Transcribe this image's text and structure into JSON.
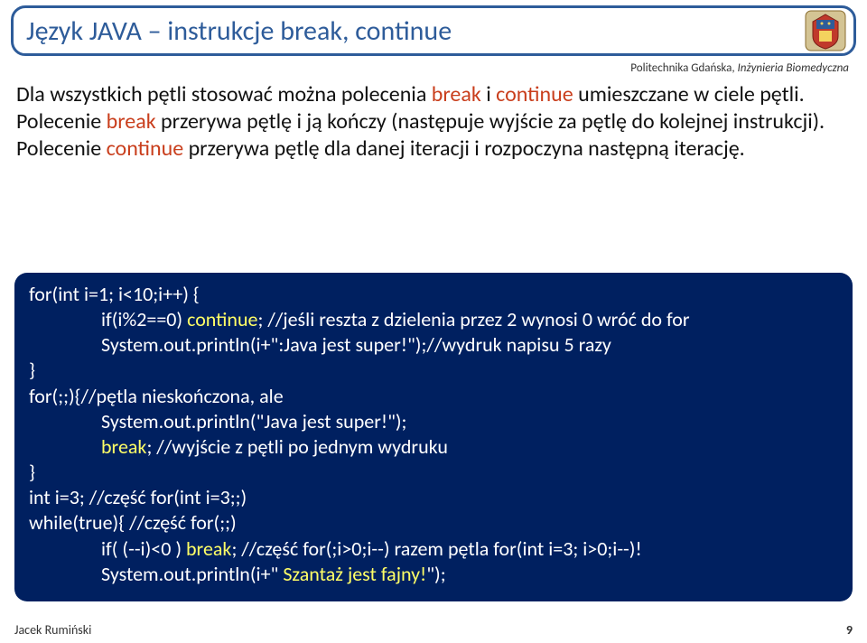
{
  "title": "Język JAVA – instrukcje break, continue",
  "subheader": {
    "uni": "Politechnika Gdańska, ",
    "dept": "Inżynieria Biomedyczna"
  },
  "para": {
    "p1a": "Dla wszystkich pętli stosować można polecenia ",
    "p1b": "break",
    "p1c": " i ",
    "p1d": "continue",
    "p1e": " umieszczane w ciele pętli. Polecenie ",
    "p1f": "break",
    "p1g": " przerywa pętlę i ją kończy (następuje wyjście za pętlę do kolejnej instrukcji). Polecenie ",
    "p1h": "continue",
    "p1i": " przerywa pętlę dla danej iteracji i rozpoczyna następną iterację."
  },
  "code": {
    "l1": "for(int i=1; i<10;i++) {",
    "l2a": "if(i%2==0) ",
    "l2b": "continue",
    "l2c": "; //jeśli reszta z dzielenia przez 2 wynosi 0  wróć do for",
    "l3": "System.out.println(i+\":Java jest super!\");//wydruk napisu 5 razy",
    "l4": "}",
    "l5": "for(;;){//pętla nieskończona, ale",
    "l6": "System.out.println(\"Java jest super!\");",
    "l7a": "break",
    "l7b": "; //wyjście z pętli po jednym wydruku",
    "l8": "}",
    "l9": "int i=3; //część for(int i=3;;)",
    "l10": "while(true){ //część for(;;)",
    "l11a": "if( (--i)<0 ) ",
    "l11b": "break",
    "l11c": "; //część for(;i>0;i--)  razem pętla for(int i=3; i>0;i--)!",
    "l12a": "System.out.println(i+\" ",
    "l12b": "Szantaż jest fajny!",
    "l12c": "\");"
  },
  "footer": {
    "author": "Jacek Rumiński",
    "page": "9"
  }
}
